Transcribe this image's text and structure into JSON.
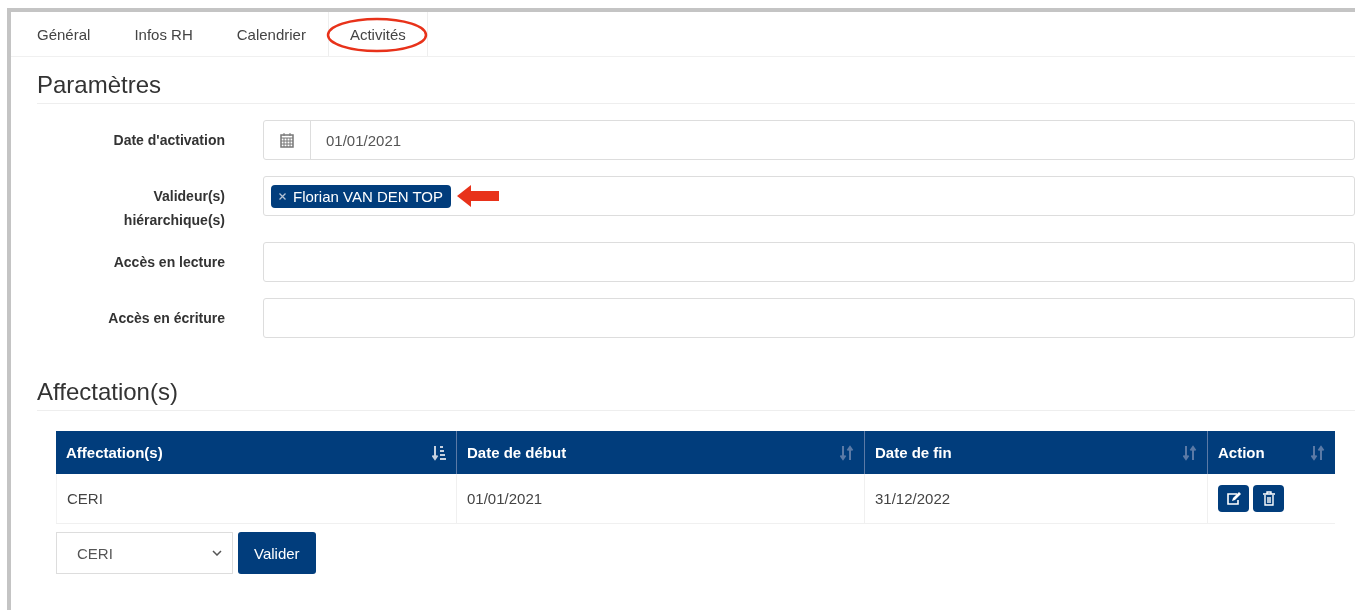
{
  "tabs": [
    {
      "label": "Général",
      "selected": false
    },
    {
      "label": "Infos RH",
      "selected": false
    },
    {
      "label": "Calendrier",
      "selected": false
    },
    {
      "label": "Activités",
      "selected": true
    }
  ],
  "parametres": {
    "title": "Paramètres",
    "fields": [
      {
        "label": "Date d'activation",
        "kind": "date",
        "value": "01/01/2021"
      },
      {
        "label": "Valideur(s) hiérarchique(s)",
        "kind": "tags",
        "tags": [
          "Florian VAN DEN TOP"
        ]
      },
      {
        "label": "Accès en lecture",
        "kind": "text"
      },
      {
        "label": "Accès en écriture",
        "kind": "text"
      }
    ]
  },
  "affectations": {
    "title": "Affectation(s)",
    "table": {
      "columns": [
        {
          "label": "Affectation(s)",
          "sorted": true
        },
        {
          "label": "Date de début",
          "sorted": false
        },
        {
          "label": "Date de fin",
          "sorted": false
        },
        {
          "label": "Action",
          "sorted": false
        }
      ],
      "rows": [
        {
          "cells": [
            "CERI",
            "01/01/2021",
            "31/12/2022"
          ]
        }
      ]
    },
    "select": {
      "value": "CERI"
    },
    "button": "Valider"
  }
}
